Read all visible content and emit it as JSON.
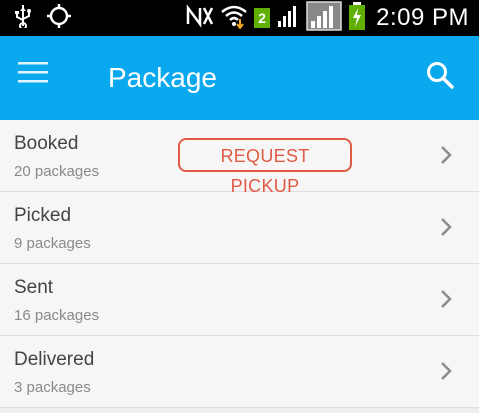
{
  "status_bar": {
    "time": "2:09 PM",
    "sim_badge": "2",
    "icons": [
      "usb-icon",
      "gps-icon",
      "nfc-icon",
      "wifi-icon",
      "signal-icon",
      "signal-icon-2",
      "battery-charging-icon"
    ]
  },
  "app_bar": {
    "title": "Package",
    "color": "#0aa8ee"
  },
  "list": {
    "items": [
      {
        "title": "Booked",
        "subtitle": "20 packages",
        "action": "REQUEST PICKUP"
      },
      {
        "title": "Picked",
        "subtitle": "9 packages"
      },
      {
        "title": "Sent",
        "subtitle": "16 packages"
      },
      {
        "title": "Delivered",
        "subtitle": "3 packages"
      }
    ]
  },
  "colors": {
    "accent": "#0aa8ee",
    "action": "#e05a44"
  }
}
